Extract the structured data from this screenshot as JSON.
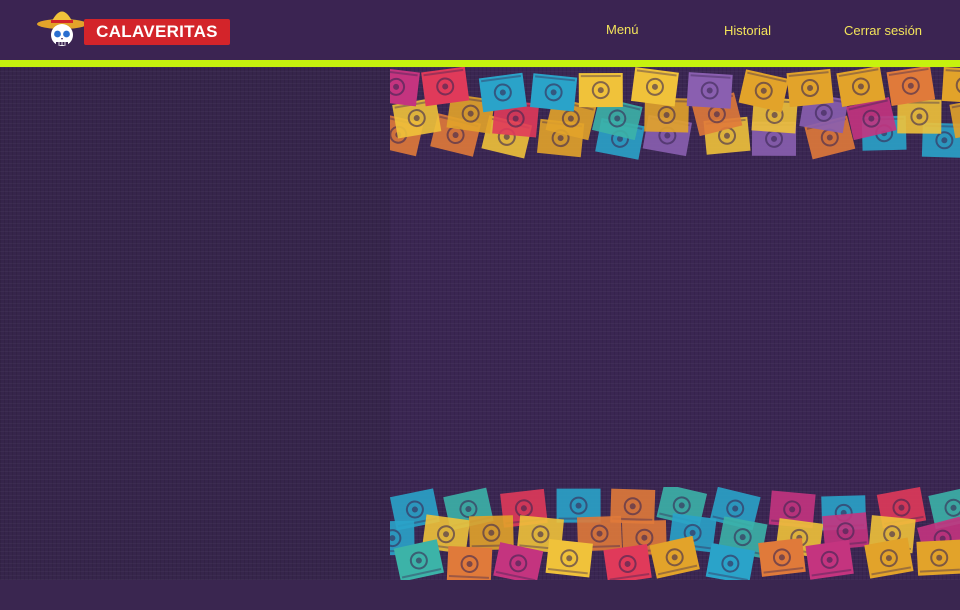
{
  "header": {
    "logo_text": "CALAVERITAS",
    "nav": {
      "menu": "Menú",
      "history": "Historial",
      "logout": "Cerrar sesión"
    }
  },
  "colors": {
    "header_bg": "#3b2452",
    "accent_bar": "#c6f20e",
    "nav_text": "#f3e45a",
    "logo_red": "#d3242a",
    "papel_palette": [
      "#e2a32a",
      "#2aa3c9",
      "#c4347f",
      "#e07a3a",
      "#8a5fb0",
      "#f0c23a",
      "#e03a5a",
      "#3cb3a8"
    ]
  },
  "icons": {
    "logo": "sugar-skull-sombrero-icon"
  }
}
